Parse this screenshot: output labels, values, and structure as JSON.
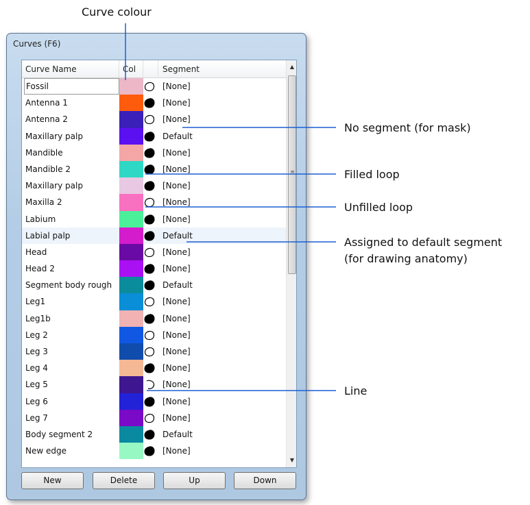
{
  "annotations": {
    "curve_colour": "Curve colour",
    "no_segment": "No segment (for mask)",
    "filled_loop": "Filled loop",
    "unfilled_loop": "Unfilled loop",
    "default_segment_line1": "Assigned to default segment",
    "default_segment_line2": "(for drawing anatomy)",
    "line": "Line"
  },
  "window": {
    "title": "Curves (F6)"
  },
  "table": {
    "headers": {
      "name": "Curve Name",
      "col": "Col",
      "segment": "Segment"
    },
    "rows": [
      {
        "name": "Fossil",
        "color": "#ecb8c8",
        "loop": "unfilled",
        "segment": "[None]"
      },
      {
        "name": "Antenna 1",
        "color": "#ff5b0c",
        "loop": "filled",
        "segment": "[None]"
      },
      {
        "name": "Antenna 2",
        "color": "#3a20b8",
        "loop": "unfilled",
        "segment": "[None]"
      },
      {
        "name": "Maxillary palp",
        "color": "#5a10f0",
        "loop": "filled",
        "segment": "Default"
      },
      {
        "name": "Mandible",
        "color": "#f4a6a6",
        "loop": "filled",
        "segment": "[None]"
      },
      {
        "name": "Mandible 2",
        "color": "#2ed8c4",
        "loop": "filled",
        "segment": "[None]"
      },
      {
        "name": "Maxillary palp",
        "color": "#e8c8e2",
        "loop": "filled",
        "segment": "[None]"
      },
      {
        "name": "Maxilla 2",
        "color": "#f870c0",
        "loop": "unfilled",
        "segment": "[None]"
      },
      {
        "name": "Labium",
        "color": "#4cf09a",
        "loop": "filled",
        "segment": "[None]"
      },
      {
        "name": "Labial palp",
        "color": "#d41ccc",
        "loop": "filled",
        "segment": "Default"
      },
      {
        "name": "Head",
        "color": "#6a0aa4",
        "loop": "unfilled",
        "segment": "[None]"
      },
      {
        "name": "Head 2",
        "color": "#aa10f4",
        "loop": "filled",
        "segment": "[None]"
      },
      {
        "name": "Segment body rough",
        "color": "#0a8c9c",
        "loop": "filled",
        "segment": "Default"
      },
      {
        "name": "Leg1",
        "color": "#0a8ed8",
        "loop": "unfilled",
        "segment": "[None]"
      },
      {
        "name": "Leg1b",
        "color": "#f0b2b2",
        "loop": "filled",
        "segment": "[None]"
      },
      {
        "name": "Leg 2",
        "color": "#1058e4",
        "loop": "unfilled",
        "segment": "[None]"
      },
      {
        "name": "Leg 3",
        "color": "#104cac",
        "loop": "unfilled",
        "segment": "[None]"
      },
      {
        "name": "Leg 4",
        "color": "#f4b894",
        "loop": "filled",
        "segment": "[None]"
      },
      {
        "name": "Leg 5",
        "color": "#3e1690",
        "loop": "line",
        "segment": "[None]"
      },
      {
        "name": "Leg 6",
        "color": "#2222d8",
        "loop": "filled",
        "segment": "[None]"
      },
      {
        "name": "Leg 7",
        "color": "#7a0ac8",
        "loop": "unfilled",
        "segment": "[None]"
      },
      {
        "name": "Body segment 2",
        "color": "#0a8aa0",
        "loop": "filled",
        "segment": "Default"
      },
      {
        "name": "New edge",
        "color": "#98f8c4",
        "loop": "filled",
        "segment": "[None]"
      }
    ]
  },
  "buttons": {
    "new": "New",
    "delete": "Delete",
    "up": "Up",
    "down": "Down"
  }
}
